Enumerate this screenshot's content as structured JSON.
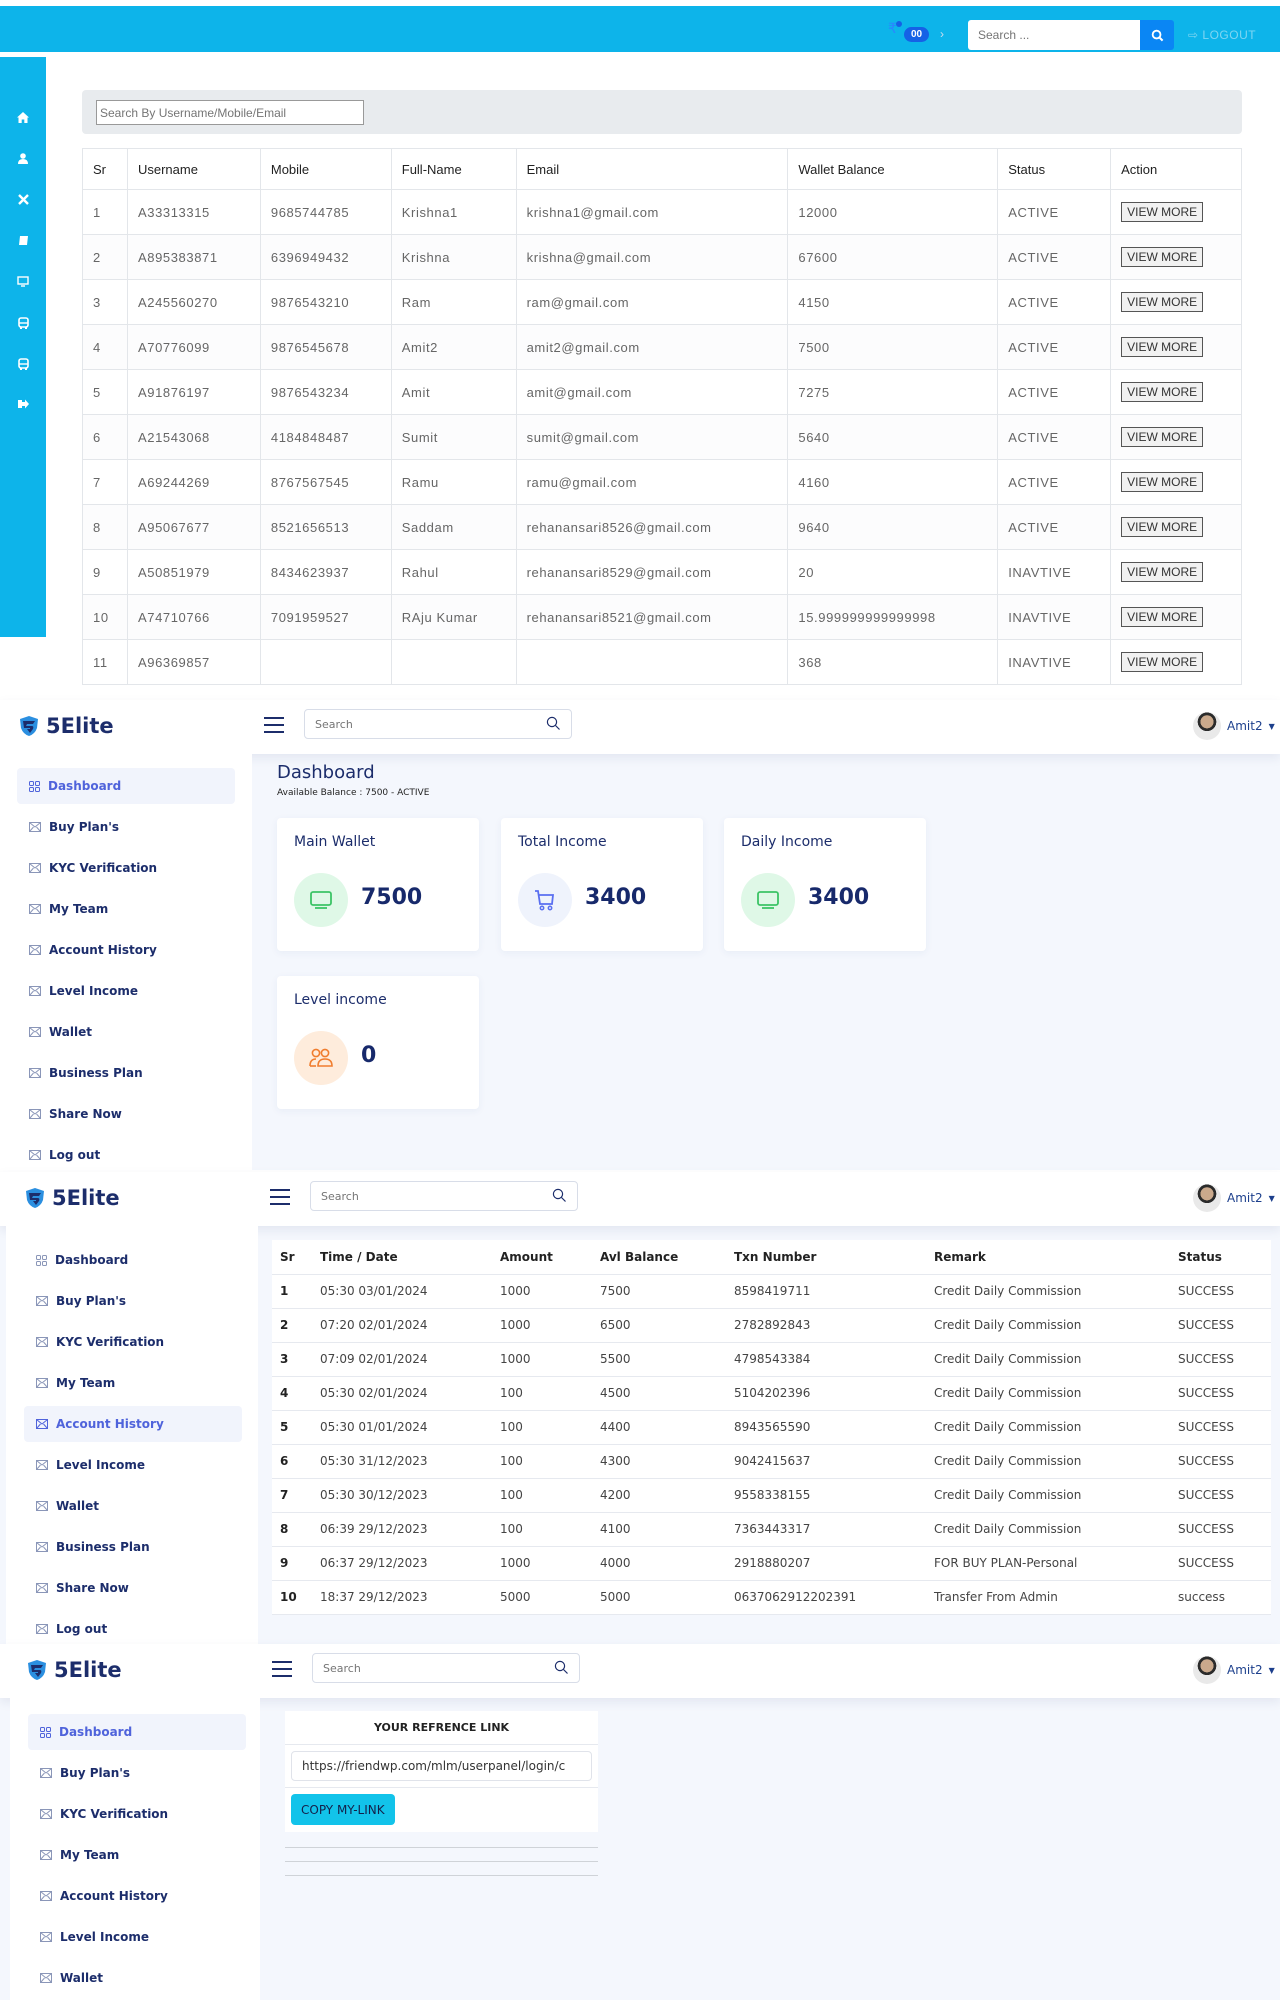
{
  "admin": {
    "topbar": {
      "currency_icon": "rupee-icon",
      "badge_count": "00",
      "search_placeholder": "Search ...",
      "logout_label": "LOGOUT"
    },
    "sidebar_icons": [
      "home-icon",
      "user-icon",
      "plane-icon",
      "book-icon",
      "monitor-icon",
      "bus-icon",
      "bus-icon",
      "sign-out-icon"
    ],
    "filter_placeholder": "Search By Username/Mobile/Email",
    "table": {
      "headers": [
        "Sr",
        "Username",
        "Mobile",
        "Full-Name",
        "Email",
        "Wallet Balance",
        "Status",
        "Action"
      ],
      "action_label": "VIEW MORE",
      "rows": [
        [
          "1",
          "A33313315",
          "9685744785",
          "Krishna1",
          "krishna1@gmail.com",
          "12000",
          "ACTIVE"
        ],
        [
          "2",
          "A895383871",
          "6396949432",
          "Krishna",
          "krishna@gmail.com",
          "67600",
          "ACTIVE"
        ],
        [
          "3",
          "A245560270",
          "9876543210",
          "Ram",
          "ram@gmail.com",
          "4150",
          "ACTIVE"
        ],
        [
          "4",
          "A70776099",
          "9876545678",
          "Amit2",
          "amit2@gmail.com",
          "7500",
          "ACTIVE"
        ],
        [
          "5",
          "A91876197",
          "9876543234",
          "Amit",
          "amit@gmail.com",
          "7275",
          "ACTIVE"
        ],
        [
          "6",
          "A21543068",
          "4184848487",
          "Sumit",
          "sumit@gmail.com",
          "5640",
          "ACTIVE"
        ],
        [
          "7",
          "A69244269",
          "8767567545",
          "Ramu",
          "ramu@gmail.com",
          "4160",
          "ACTIVE"
        ],
        [
          "8",
          "A95067677",
          "8521656513",
          "Saddam",
          "rehanansari8526@gmail.com",
          "9640",
          "ACTIVE"
        ],
        [
          "9",
          "A50851979",
          "8434623937",
          "Rahul",
          "rehanansari8529@gmail.com",
          "20",
          "INAVTIVE"
        ],
        [
          "10",
          "A74710766",
          "7091959527",
          "RAju Kumar",
          "rehanansari8521@gmail.com",
          "15.999999999999998",
          "INAVTIVE"
        ],
        [
          "11",
          "A96369857",
          "",
          "",
          "",
          "368",
          "INAVTIVE"
        ]
      ]
    }
  },
  "app": {
    "brand": "5Elite",
    "search_placeholder": "Search",
    "user_name": "Amit2",
    "colors": {
      "accent": "#4f63db",
      "navy": "#1c2d6b",
      "cyan": "#12c3ea",
      "topbar": "#0db4ea"
    },
    "nav": [
      "Dashboard",
      "Buy Plan's",
      "KYC Verification",
      "My Team",
      "Account History",
      "Level Income",
      "Wallet",
      "Business Plan",
      "Share Now",
      "Log out"
    ]
  },
  "dashboard": {
    "title": "Dashboard",
    "subtitle": "Available Balance : 7500 - ACTIVE",
    "cards": [
      {
        "label": "Main Wallet",
        "value": "7500",
        "icon": "monitor-icon"
      },
      {
        "label": "Total Income",
        "value": "3400",
        "icon": "cart-icon"
      },
      {
        "label": "Daily Income",
        "value": "3400",
        "icon": "monitor-icon"
      },
      {
        "label": "Level income",
        "value": "0",
        "icon": "users-icon"
      }
    ]
  },
  "history": {
    "headers": [
      "Sr",
      "Time / Date",
      "Amount",
      "Avl Balance",
      "Txn Number",
      "Remark",
      "Status"
    ],
    "rows": [
      [
        "1",
        "05:30 03/01/2024",
        "1000",
        "7500",
        "8598419711",
        "Credit Daily Commission",
        "SUCCESS"
      ],
      [
        "2",
        "07:20 02/01/2024",
        "1000",
        "6500",
        "2782892843",
        "Credit Daily Commission",
        "SUCCESS"
      ],
      [
        "3",
        "07:09 02/01/2024",
        "1000",
        "5500",
        "4798543384",
        "Credit Daily Commission",
        "SUCCESS"
      ],
      [
        "4",
        "05:30 02/01/2024",
        "100",
        "4500",
        "5104202396",
        "Credit Daily Commission",
        "SUCCESS"
      ],
      [
        "5",
        "05:30 01/01/2024",
        "100",
        "4400",
        "8943565590",
        "Credit Daily Commission",
        "SUCCESS"
      ],
      [
        "6",
        "05:30 31/12/2023",
        "100",
        "4300",
        "9042415637",
        "Credit Daily Commission",
        "SUCCESS"
      ],
      [
        "7",
        "05:30 30/12/2023",
        "100",
        "4200",
        "9558338155",
        "Credit Daily Commission",
        "SUCCESS"
      ],
      [
        "8",
        "06:39 29/12/2023",
        "100",
        "4100",
        "7363443317",
        "Credit Daily Commission",
        "SUCCESS"
      ],
      [
        "9",
        "06:37 29/12/2023",
        "1000",
        "4000",
        "2918880207",
        "FOR BUY PLAN-Personal",
        "SUCCESS"
      ],
      [
        "10",
        "18:37 29/12/2023",
        "5000",
        "5000",
        "0637062912202391",
        "Transfer From Admin",
        "success"
      ]
    ]
  },
  "reference": {
    "title": "YOUR REFRENCE LINK",
    "link_value": "https://friendwp.com/mlm/userpanel/login/c",
    "copy_label": "COPY MY-LINK"
  }
}
